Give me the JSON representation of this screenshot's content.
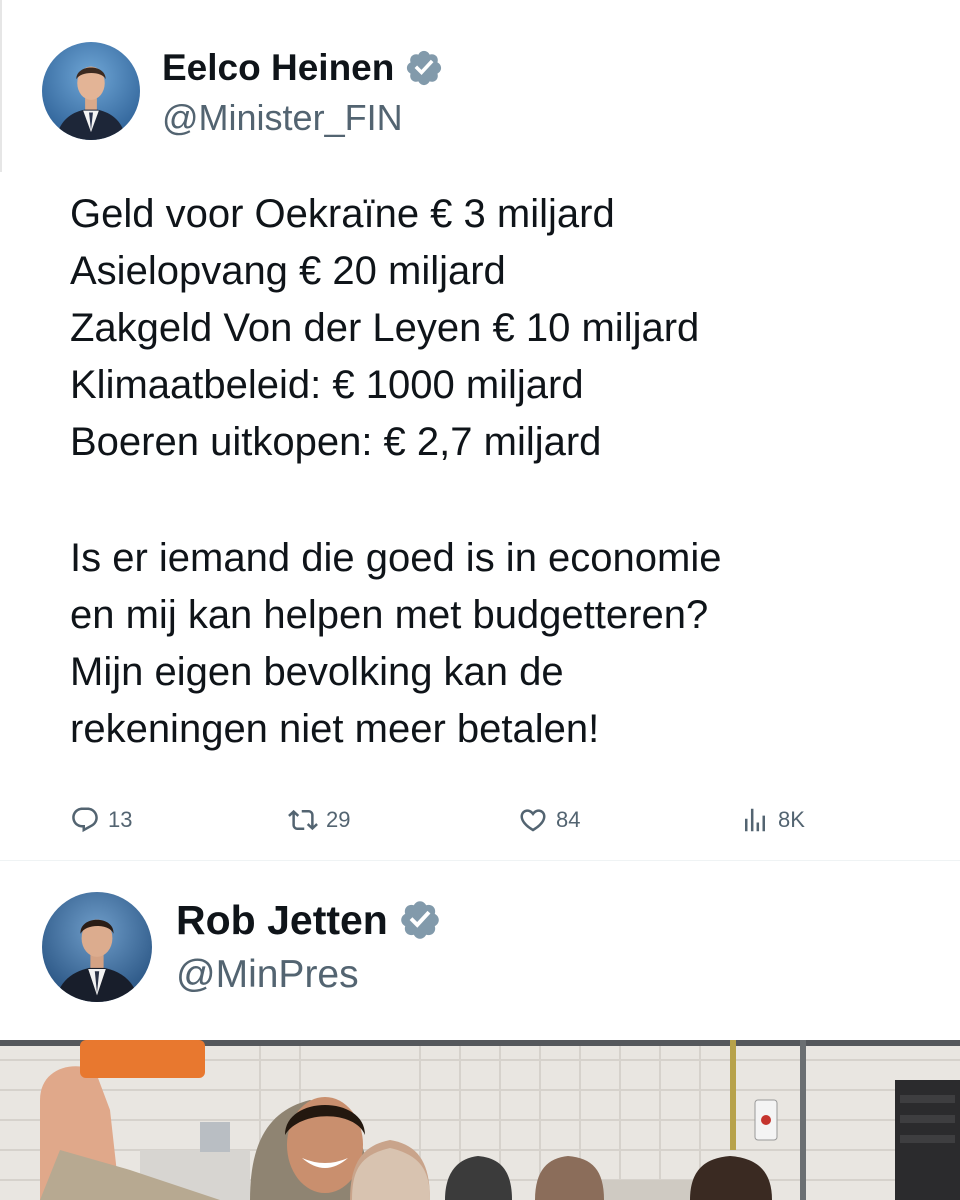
{
  "tweet1": {
    "author_name": "Eelco Heinen",
    "author_handle": "@Minister_FIN",
    "body_lines": [
      "Geld voor Oekraïne € 3 miljard",
      "Asielopvang € 20 miljard",
      "Zakgeld Von der Leyen € 10 miljard",
      "Klimaatbeleid: € 1000 miljard",
      "Boeren uitkopen: € 2,7 miljard"
    ],
    "body_question_lines": [
      "Is er iemand die goed is in economie",
      "en mij kan helpen met budgetteren?",
      "Mijn eigen bevolking kan de",
      "rekeningen niet meer betalen!"
    ],
    "actions": {
      "replies": "13",
      "reposts": "29",
      "likes": "84",
      "views": "8K"
    }
  },
  "tweet2": {
    "author_name": "Rob Jetten",
    "author_handle": "@MinPres"
  },
  "icons": {
    "verified": "verified-badge-icon",
    "reply": "reply-icon",
    "repost": "repost-icon",
    "like": "heart-icon",
    "views": "views-chart-icon"
  },
  "colors": {
    "text_primary": "#0f1419",
    "text_secondary": "#536471",
    "verified_badge": "#829aab"
  }
}
